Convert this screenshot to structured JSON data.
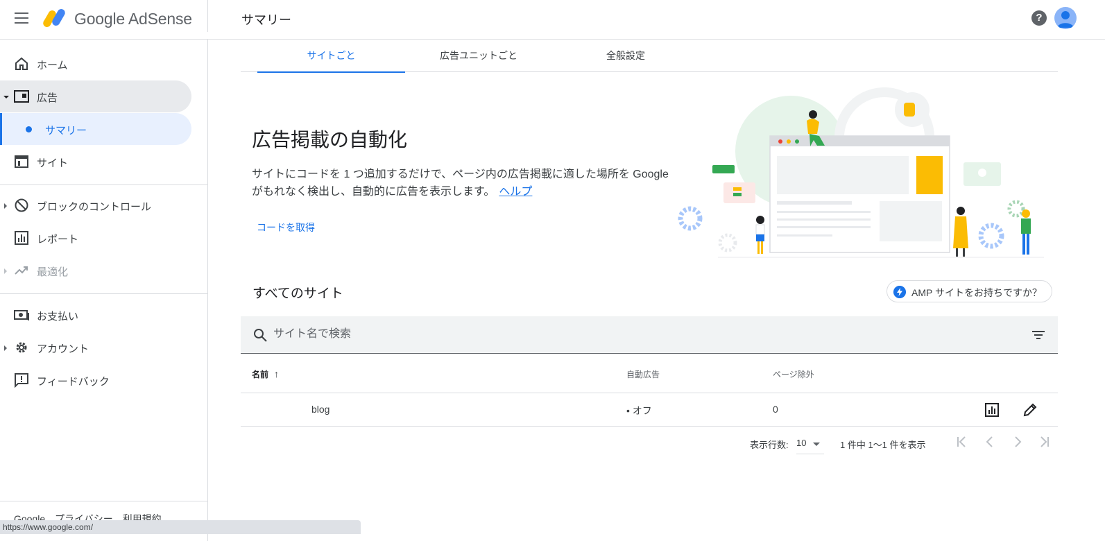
{
  "header": {
    "logo_text": "Google AdSense",
    "page_title": "サマリー",
    "help_symbol": "?"
  },
  "sidebar": {
    "items": [
      {
        "label": "ホーム",
        "icon": "home-icon"
      },
      {
        "label": "広告",
        "icon": "ads-icon"
      },
      {
        "label": "サマリー"
      },
      {
        "label": "サイト",
        "icon": "sites-icon"
      },
      {
        "label": "ブロックのコントロール",
        "icon": "block-icon"
      },
      {
        "label": "レポート",
        "icon": "report-icon"
      },
      {
        "label": "最適化",
        "icon": "trending-up-icon"
      },
      {
        "label": "お支払い",
        "icon": "payments-icon"
      },
      {
        "label": "アカウント",
        "icon": "gear-icon"
      },
      {
        "label": "フィードバック",
        "icon": "feedback-icon"
      }
    ],
    "footer": [
      "Google",
      "プライバシー",
      "利用規約"
    ]
  },
  "status_bar": {
    "url": "https://www.google.com/"
  },
  "tabs": [
    {
      "label": "サイトごと",
      "active": true
    },
    {
      "label": "広告ユニットごと",
      "active": false
    },
    {
      "label": "全般設定",
      "active": false
    }
  ],
  "hero": {
    "title": "広告掲載の自動化",
    "description": "サイトにコードを 1 つ追加するだけで、ページ内の広告掲載に適した場所を Google がもれなく検出し、自動的に広告を表示します。",
    "help_link": "ヘルプ",
    "get_code": "コードを取得"
  },
  "sites_section": {
    "title": "すべてのサイト",
    "amp_button": "AMP サイトをお持ちですか？",
    "search": {
      "placeholder": "サイト名で検索",
      "value": ""
    },
    "columns": [
      "名前",
      "自動広告",
      "ページ除外"
    ],
    "sort_symbol": "↑",
    "rows": [
      {
        "name": "blog",
        "auto_ads": "• オフ",
        "page_exclusions": "0"
      }
    ],
    "pagination": {
      "rows_label": "表示行数:",
      "rows_per_page": "10",
      "range": "1 件中 1〜1 件を表示"
    }
  },
  "colors": {
    "accent": "#1a73e8",
    "text_primary": "#202124",
    "text_secondary": "#5f6368",
    "divider": "#dadce0",
    "active_nav_bg": "#e8f0fe",
    "search_bg": "#f1f3f4"
  }
}
